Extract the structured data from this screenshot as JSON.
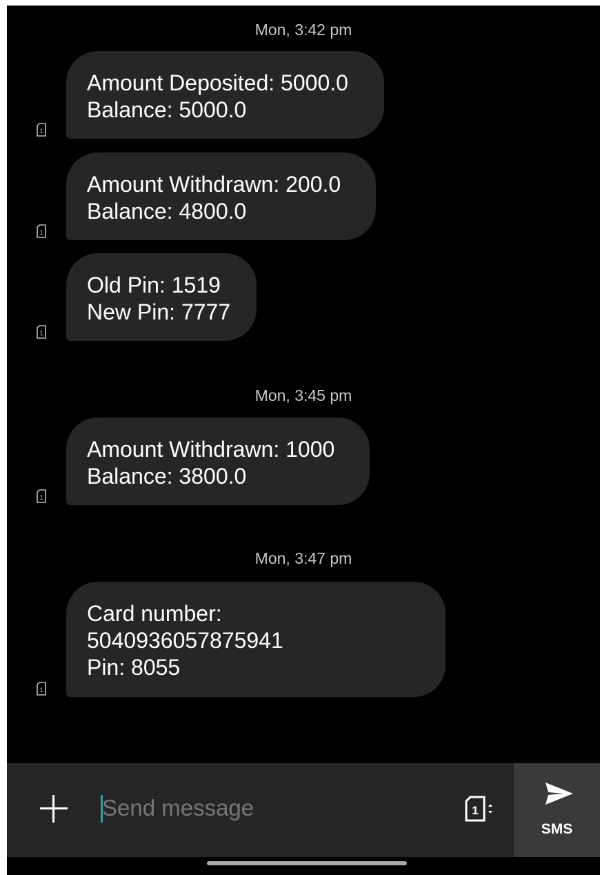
{
  "conversation": {
    "groups": [
      {
        "timestamp": "Mon, 3:42 pm",
        "messages": [
          {
            "lines": [
              "Amount Deposited: 5000.0",
              "Balance: 5000.0"
            ]
          },
          {
            "lines": [
              "Amount Withdrawn: 200.0",
              "Balance: 4800.0"
            ]
          },
          {
            "lines": [
              "Old Pin: 1519",
              "New Pin: 7777"
            ]
          }
        ]
      },
      {
        "timestamp": "Mon, 3:45 pm",
        "messages": [
          {
            "lines": [
              "Amount Withdrawn: 1000",
              "Balance: 3800.0"
            ]
          }
        ]
      },
      {
        "timestamp": "Mon, 3:47 pm",
        "messages": [
          {
            "lines": [
              "Card number:",
              "5040936057875941",
              "Pin: 8055"
            ]
          }
        ]
      }
    ],
    "sim_badge": "1"
  },
  "composer": {
    "placeholder": "Send message",
    "sim_slot": "1",
    "send_label": "SMS"
  },
  "colors": {
    "background": "#000000",
    "bubble": "#262626",
    "composer": "#252525",
    "send_button": "#3a3a3a",
    "caret": "#2aa7a3"
  },
  "icons": {
    "add": "plus-icon",
    "sim": "sim-card-icon",
    "send": "send-icon"
  }
}
